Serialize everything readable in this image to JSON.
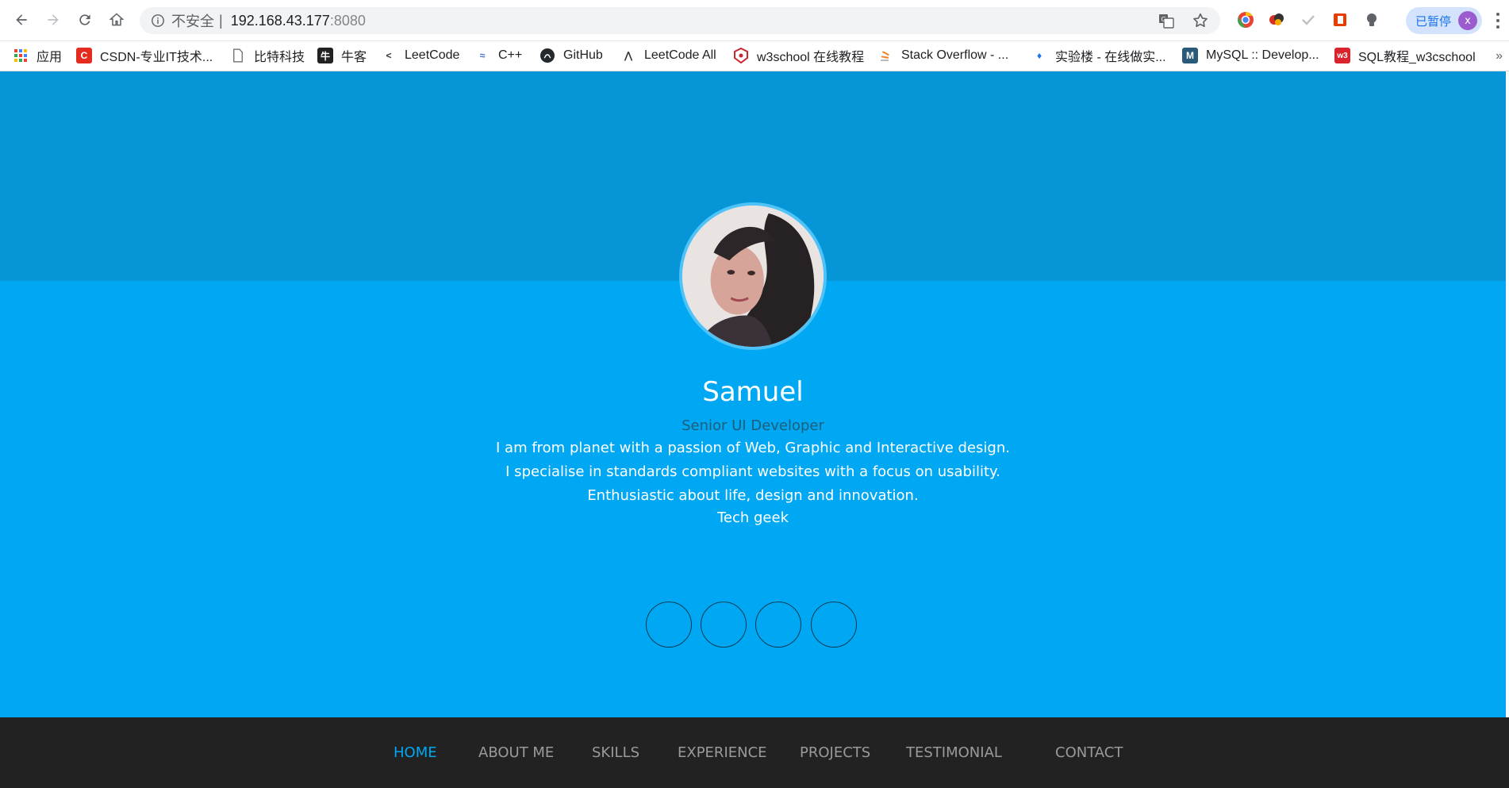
{
  "browser": {
    "security_label": "不安全",
    "url_host": "192.168.43.177",
    "url_port": ":8080",
    "profile_status": "已暂停",
    "profile_initial": "x",
    "icons": {
      "back": "arrow-left-icon",
      "forward": "arrow-right-icon",
      "reload": "reload-icon",
      "home": "home-icon",
      "translate": "translate-icon",
      "bookmark": "star-icon"
    }
  },
  "bookmarks": [
    {
      "label": "应用"
    },
    {
      "label": "CSDN-专业IT技术..."
    },
    {
      "label": "比特科技"
    },
    {
      "label": "牛客"
    },
    {
      "label": "LeetCode"
    },
    {
      "label": "C++"
    },
    {
      "label": "GitHub"
    },
    {
      "label": "LeetCode All"
    },
    {
      "label": "w3school 在线教程"
    },
    {
      "label": "Stack Overflow - ..."
    },
    {
      "label": "实验楼 - 在线做实..."
    },
    {
      "label": "MySQL :: Develop..."
    },
    {
      "label": "SQL教程_w3cschool"
    }
  ],
  "bookmarks_more": "»",
  "hero": {
    "name": "Samuel",
    "role": "Senior UI Developer",
    "bio": [
      "I am from planet with a passion of Web, Graphic and Interactive design.",
      "I specialise in standards compliant websites with a focus on usability.",
      "Enthusiastic about life, design and innovation.",
      "Tech geek"
    ],
    "social_glyph": ""
  },
  "nav": [
    {
      "label": "HOME",
      "active": true
    },
    {
      "label": "ABOUT ME"
    },
    {
      "label": "SKILLS"
    },
    {
      "label": "EXPERIENCE"
    },
    {
      "label": "PROJECTS"
    },
    {
      "label": "TESTIMONIAL"
    },
    {
      "label": "CONTACT"
    }
  ],
  "colors": {
    "hero_top": "#0695d6",
    "hero_bottom": "#00a8f3",
    "nav_bg": "#222222",
    "nav_active": "#00a8f3"
  }
}
